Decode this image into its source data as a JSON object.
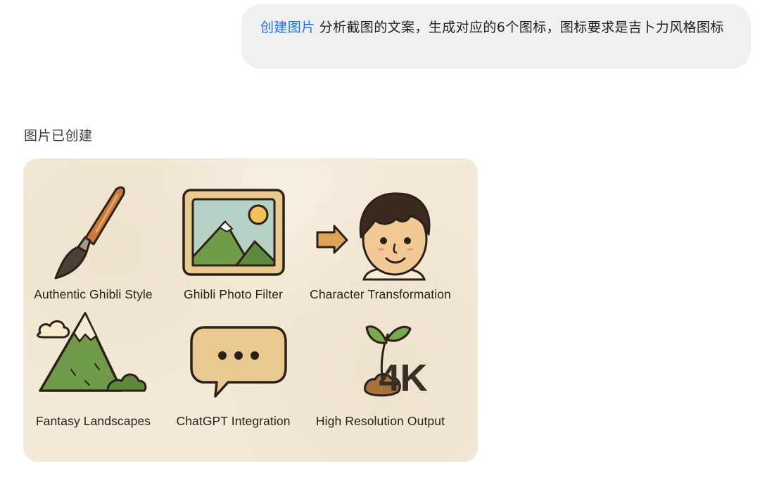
{
  "user_message": {
    "tool_tag": "创建图片",
    "text": "分析截图的文案，生成对应的6个图标，图标要求是吉卜力风格图标"
  },
  "assistant": {
    "status": "图片已创建"
  },
  "generated_image": {
    "background_color": "#f4ead8",
    "icons": [
      {
        "icon": "paintbrush-icon",
        "caption": "Authentic Ghibli Style"
      },
      {
        "icon": "framed-picture-icon",
        "caption": "Ghibli Photo Filter"
      },
      {
        "icon": "character-face-icon",
        "caption": "Character Transformation"
      },
      {
        "icon": "mountain-icon",
        "caption": "Fantasy Landscapes"
      },
      {
        "icon": "speech-bubble-icon",
        "caption": "ChatGPT Integration"
      },
      {
        "icon": "sprout-4k-icon",
        "caption": "High Resolution Output"
      }
    ],
    "sprout_badge_text": "4K"
  },
  "colors": {
    "link_blue": "#1a73e8",
    "bubble_bg": "#f0f0f0"
  }
}
